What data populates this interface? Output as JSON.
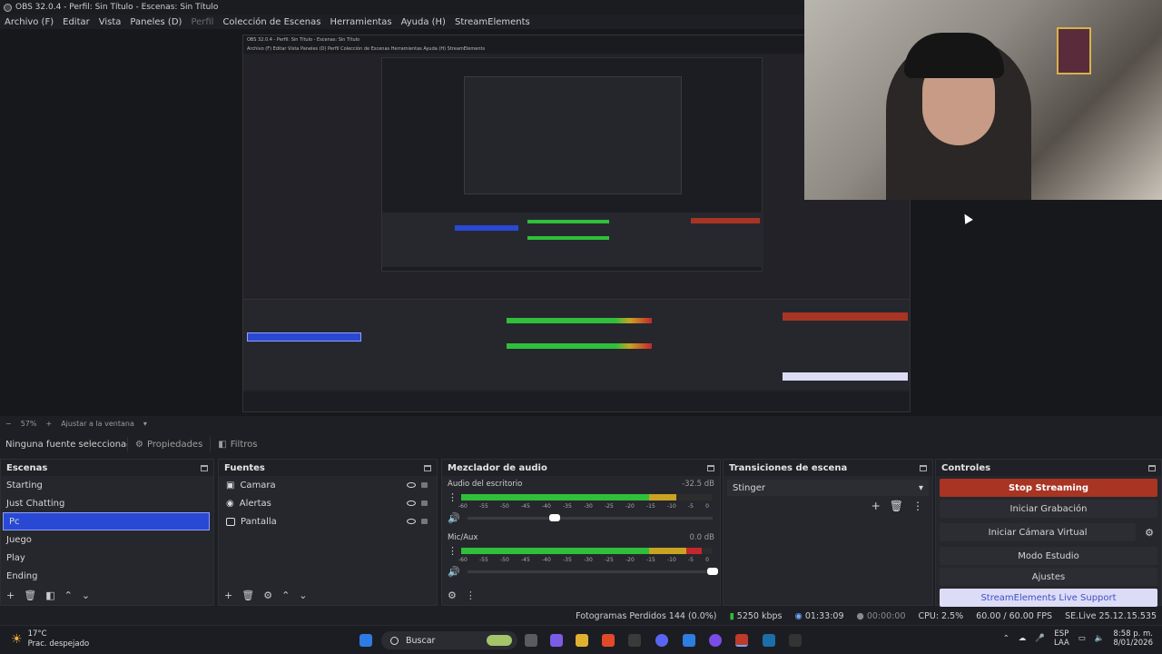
{
  "titlebar": {
    "title": "OBS 32.0.4 - Perfil: Sin Título - Escenas: Sin Título"
  },
  "menu": {
    "items": [
      "Archivo (F)",
      "Editar",
      "Vista",
      "Paneles (D)",
      "Perfil",
      "Colección de Escenas",
      "Herramientas",
      "Ayuda (H)",
      "StreamElements"
    ]
  },
  "preview": {
    "nested_title": "OBS 32.0.4 - Perfil: Sin Título - Escenas: Sin Título",
    "nested_menu": "Archivo (F)  Editar  Vista  Paneles (D)  Perfil  Colección de Escenas  Herramientas  Ayuda (H)  StreamElements"
  },
  "zoom": {
    "level": "57%",
    "fit": "Ajustar a la ventana"
  },
  "sourcebar": {
    "selected": "Ninguna fuente seleccionada",
    "properties": "Propiedades",
    "filters": "Filtros"
  },
  "scenes": {
    "header": "Escenas",
    "items": [
      "Starting",
      "Just Chatting",
      "Pc",
      "Juego",
      "Play",
      "Ending"
    ],
    "selected": "Pc"
  },
  "sources": {
    "header": "Fuentes",
    "items": [
      "Camara",
      "Alertas",
      "Pantalla"
    ]
  },
  "mixer": {
    "header": "Mezclador de audio",
    "channels": [
      {
        "name": "Audio del escritorio",
        "db": "-32.5 dB",
        "level": 0.86
      },
      {
        "name": "Mic/Aux",
        "db": "0.0 dB",
        "level": 0.96
      }
    ],
    "ticks": [
      "-60",
      "-55",
      "-50",
      "-45",
      "-40",
      "-35",
      "-30",
      "-25",
      "-20",
      "-15",
      "-10",
      "-5",
      "0"
    ]
  },
  "transitions": {
    "header": "Transiciones de escena",
    "selected": "Stinger"
  },
  "controls": {
    "header": "Controles",
    "stop_streaming": "Stop Streaming",
    "start_recording": "Iniciar Grabación",
    "virtual_camera": "Iniciar Cámara Virtual",
    "studio_mode": "Modo Estudio",
    "settings": "Ajustes",
    "live_support": "StreamElements Live Support"
  },
  "status": {
    "dropped": "Fotogramas Perdidos 144 (0.0%)",
    "bitrate": "5250 kbps",
    "stream_time": "01:33:09",
    "rec_time": "00:00:00",
    "cpu": "CPU: 2.5%",
    "fps": "60.00 / 60.00 FPS",
    "version": "SE.Live 25.12.15.535"
  },
  "taskbar": {
    "temp": "17°C",
    "weather": "Prac. despejado",
    "search": "Buscar",
    "lang1": "ESP",
    "lang2": "LAA",
    "time": "8:58 p. m.",
    "date": "8/01/2026"
  },
  "colors": {
    "accent_blue": "#2949d4",
    "stop_red": "#a83424",
    "meter_green": "#2fbf3a",
    "meter_yellow": "#c9a322",
    "meter_red": "#c2272d"
  }
}
